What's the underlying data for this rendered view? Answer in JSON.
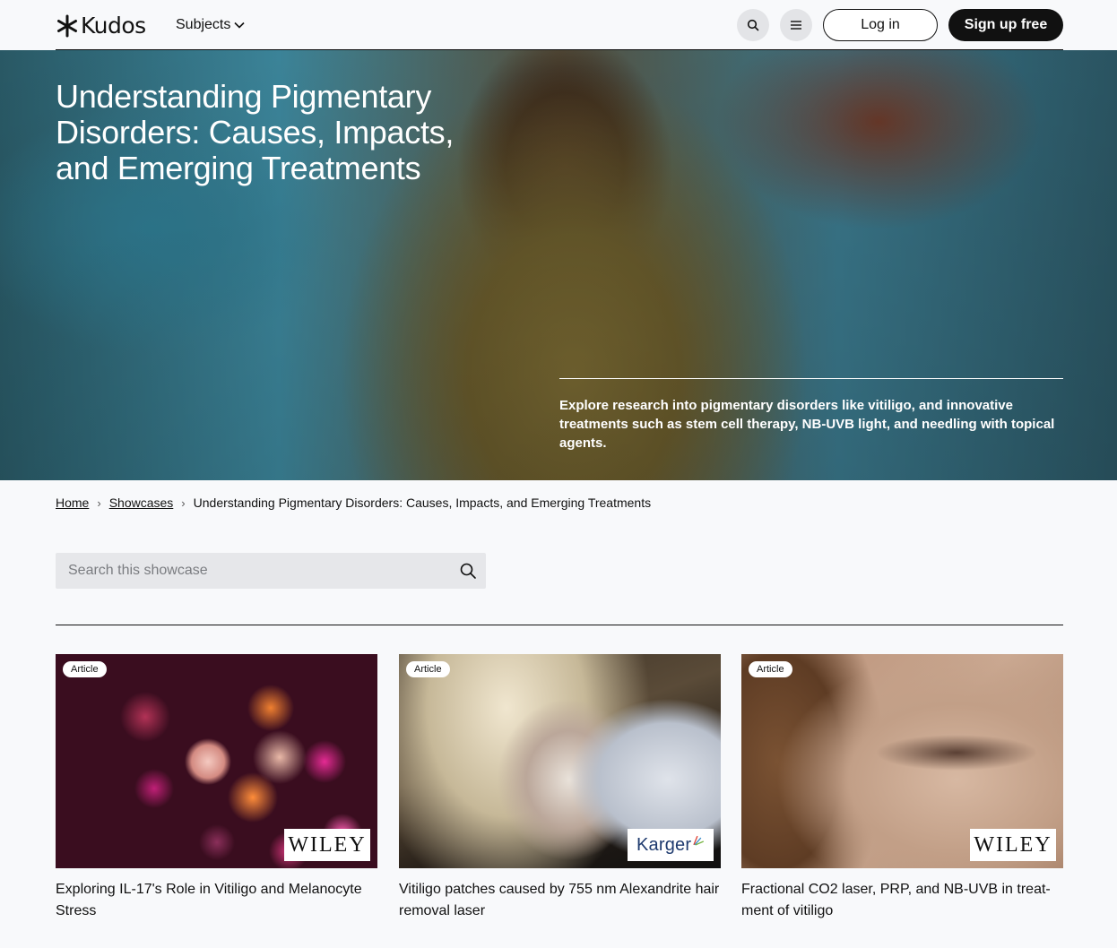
{
  "header": {
    "logo_text": "Kudos",
    "subjects_label": "Subjects",
    "search_icon": "search-icon",
    "menu_icon": "hamburger-menu-icon",
    "login_label": "Log in",
    "signup_label": "Sign up free"
  },
  "hero": {
    "title": "Understanding Pigmentary Disorders: Causes, Impacts, and Emerging Treatments",
    "description": "Explore research into pigmentary disorders like vitiligo, and innovative treatments such as stem cell therapy, NB-UVB light, and needling with topical agents."
  },
  "breadcrumb": {
    "home": "Home",
    "showcases": "Showcases",
    "current": "Understanding Pigmentary Disorders: Causes, Impacts, and Emerging Treatments"
  },
  "search": {
    "placeholder": "Search this showcase"
  },
  "cards": [
    {
      "badge": "Article",
      "publisher": "WILEY",
      "title": "Exploring IL-17's Role in Vitiligo and Melanocyte Stress"
    },
    {
      "badge": "Article",
      "publisher": "Karger",
      "title": "Vitiligo patches caused by 755 nm Alexandrite hair removal laser"
    },
    {
      "badge": "Article",
      "publisher": "WILEY",
      "title": "Fractional CO2 laser, PRP, and NB-UVB in treat-ment of vitiligo"
    }
  ],
  "colors": {
    "background": "#f8f9fb",
    "text": "#111111",
    "signup_bg": "#111111",
    "search_bg": "#e6e7ea"
  }
}
